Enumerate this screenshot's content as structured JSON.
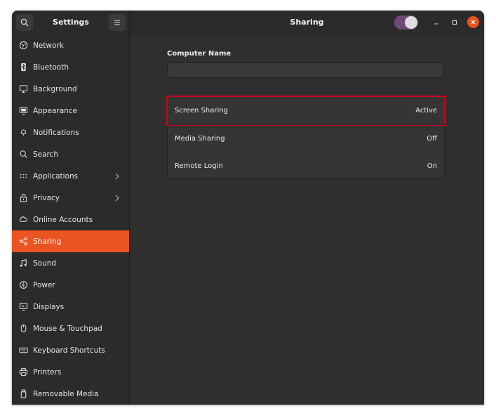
{
  "window": {
    "sidebar_title": "Settings",
    "main_title": "Sharing"
  },
  "icons": {
    "search": "search-icon",
    "menu": "hamburger-menu-icon",
    "minimize": "minimize-icon",
    "maximize": "maximize-icon",
    "close": "close-icon"
  },
  "colors": {
    "accent": "#e95420",
    "toggle_on": "#6e4a77",
    "highlight_box": "#d0021b"
  },
  "sharing_toggle": {
    "state": "on"
  },
  "sidebar": {
    "items": [
      {
        "label": "Network",
        "icon": "network-icon"
      },
      {
        "label": "Bluetooth",
        "icon": "bluetooth-icon"
      },
      {
        "label": "Background",
        "icon": "background-icon"
      },
      {
        "label": "Appearance",
        "icon": "appearance-icon"
      },
      {
        "label": "Notifications",
        "icon": "bell-icon"
      },
      {
        "label": "Search",
        "icon": "search-icon"
      },
      {
        "label": "Applications",
        "icon": "grid-icon",
        "has_submenu": true
      },
      {
        "label": "Privacy",
        "icon": "lock-icon",
        "has_submenu": true
      },
      {
        "label": "Online Accounts",
        "icon": "cloud-icon"
      },
      {
        "label": "Sharing",
        "icon": "share-icon",
        "active": true
      },
      {
        "label": "Sound",
        "icon": "music-note-icon"
      },
      {
        "label": "Power",
        "icon": "power-icon"
      },
      {
        "label": "Displays",
        "icon": "display-icon"
      },
      {
        "label": "Mouse & Touchpad",
        "icon": "mouse-icon"
      },
      {
        "label": "Keyboard Shortcuts",
        "icon": "keyboard-icon"
      },
      {
        "label": "Printers",
        "icon": "printer-icon"
      },
      {
        "label": "Removable Media",
        "icon": "usb-drive-icon"
      }
    ]
  },
  "main": {
    "computer_name_label": "Computer Name",
    "computer_name_value": "",
    "rows": [
      {
        "label": "Screen Sharing",
        "status": "Active",
        "highlighted": true
      },
      {
        "label": "Media Sharing",
        "status": "Off"
      },
      {
        "label": "Remote Login",
        "status": "On"
      }
    ]
  }
}
